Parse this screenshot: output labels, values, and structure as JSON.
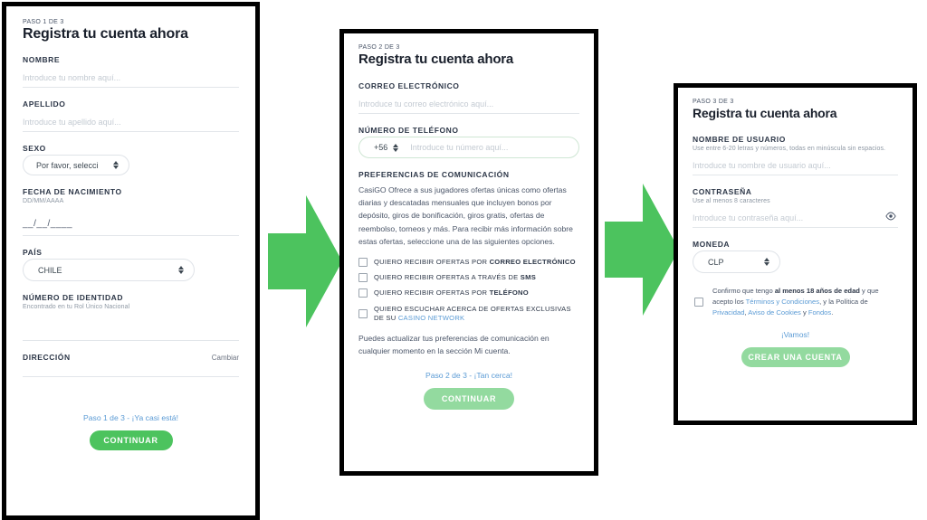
{
  "theme": {
    "cta_active_color": "#4cc35e",
    "cta_disabled_color": "#93da9f",
    "arrow_color": "#4cc35e",
    "link_color": "#5b9bd5",
    "panel_border_color": "#000000"
  },
  "panel1": {
    "eyebrow": "PASO 1 DE 3",
    "title": "Registra tu cuenta ahora",
    "nombre": {
      "label": "NOMBRE",
      "value": "",
      "placeholder": "Introduce tu nombre aquí..."
    },
    "apellido": {
      "label": "APELLIDO",
      "value": "",
      "placeholder": "Introduce tu apellido aquí..."
    },
    "sexo": {
      "label": "SEXO",
      "selected": "Por favor, selecci"
    },
    "fecha": {
      "label": "FECHA DE NACIMIENTO",
      "hint": "DD/MM/AAAA",
      "mask": "__/__/____"
    },
    "pais": {
      "label": "PAÍS",
      "selected": "CHILE"
    },
    "identidad": {
      "label": "NÚMERO DE IDENTIDAD",
      "hint": "Encontrado en tu Rol Único Nacional",
      "value": "",
      "placeholder": ""
    },
    "direccion": {
      "label": "DIRECCIÓN",
      "change_label": "Cambiar"
    },
    "footer": {
      "step_link": "Paso 1 de 3 - ¡Ya casi está!",
      "cta_label": "CONTINUAR"
    }
  },
  "panel2": {
    "eyebrow": "PASO 2 DE 3",
    "title": "Registra tu cuenta ahora",
    "correo": {
      "label": "CORREO ELECTRÓNICO",
      "value": "",
      "placeholder": "Introduce tu correo electrónico aquí..."
    },
    "telefono": {
      "label": "NÚMERO DE TELÉFONO",
      "country_code": "+56",
      "value": "",
      "placeholder": "Introduce tu número aquí..."
    },
    "preferencias": {
      "label": "PREFERENCIAS DE COMUNICACIÓN",
      "body": "CasiGO Ofrece a sus jugadores ofertas únicas como ofertas diarias y descatadas mensuales que incluyen bonos por depósito, giros de bonificación, giros gratis, ofertas de reembolso, torneos y más. Para recibir más información sobre estas ofertas, seleccione una de las siguientes opciones.",
      "options": [
        {
          "prefix": "QUIERO RECIBIR OFERTAS POR ",
          "strong": "CORREO ELECTRÓNICO",
          "suffix": "",
          "checked": false,
          "name": "email"
        },
        {
          "prefix": "QUIERO RECIBIR OFERTAS A TRAVÉS DE ",
          "strong": "SMS",
          "suffix": "",
          "checked": false,
          "name": "sms"
        },
        {
          "prefix": "QUIERO RECIBIR OFERTAS POR ",
          "strong": "TELÉFONO",
          "suffix": "",
          "checked": false,
          "name": "telefono"
        },
        {
          "prefix": "QUIERO ESCUCHAR ACERCA DE OFERTAS EXCLUSIVAS DE SU ",
          "strong": "",
          "link": "CASINO NETWORK",
          "suffix": "",
          "checked": false,
          "name": "casino-network"
        }
      ],
      "note": "Puedes actualizar tus preferencias de comunicación en cualquier momento en la sección Mi cuenta."
    },
    "footer": {
      "step_link": "Paso 2 de 3 - ¡Tan cerca!",
      "cta_label": "CONTINUAR"
    }
  },
  "panel3": {
    "eyebrow": "PASO 3 DE 3",
    "title": "Registra tu cuenta ahora",
    "usuario": {
      "label": "NOMBRE DE USUARIO",
      "hint": "Use entre 6-20 letras y números, todas en minúscula sin espacios.",
      "value": "",
      "placeholder": "Introduce tu nombre de usuario aquí..."
    },
    "contrasena": {
      "label": "CONTRASEÑA",
      "hint": "Use al menos 8 caracteres",
      "value": "",
      "placeholder": "Introduce tu contraseña aquí..."
    },
    "moneda": {
      "label": "MONEDA",
      "selected": "CLP"
    },
    "consent": {
      "checked": false,
      "part1": "Confirmo que tengo ",
      "bold1": "al menos 18 años de edad",
      "part2": " y que acepto los ",
      "link1": "Términos y Condiciones",
      "part3": ", y la Política de ",
      "link2": "Privacidad",
      "part4": ", ",
      "link3": "Aviso de Cookies",
      "part5": " y ",
      "link4": "Fondos",
      "part6": "."
    },
    "footer": {
      "step_link": "¡Vamos!",
      "cta_label": "CREAR UNA CUENTA"
    }
  }
}
